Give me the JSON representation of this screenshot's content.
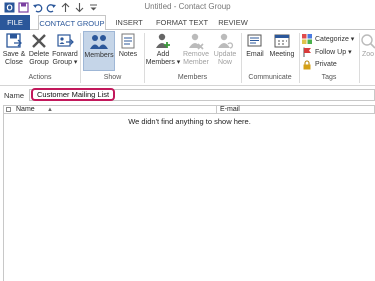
{
  "window": {
    "title": "Untitled - Contact Group"
  },
  "tabs": {
    "file": "FILE",
    "contact_group": "CONTACT GROUP",
    "insert": "INSERT",
    "format_text": "FORMAT TEXT",
    "review": "REVIEW"
  },
  "ribbon": {
    "actions": {
      "group_label": "Actions",
      "save_close": [
        "Save &",
        "Close"
      ],
      "delete_group": [
        "Delete",
        "Group"
      ],
      "forward_group": [
        "Forward",
        "Group ▾"
      ]
    },
    "show": {
      "group_label": "Show",
      "members": "Members",
      "notes": "Notes"
    },
    "members": {
      "group_label": "Members",
      "add_members": [
        "Add",
        "Members ▾"
      ],
      "remove_member": [
        "Remove",
        "Member"
      ],
      "update_now": [
        "Update",
        "Now"
      ]
    },
    "communicate": {
      "group_label": "Communicate",
      "email": "Email",
      "meeting": "Meeting"
    },
    "tags": {
      "group_label": "Tags",
      "categorize": "Categorize ▾",
      "follow_up": "Follow Up ▾",
      "private": "Private"
    },
    "zoom": {
      "label": "Zoo"
    }
  },
  "name_field": {
    "label": "Name",
    "value": "Customer Mailing List"
  },
  "list": {
    "col_name": "Name",
    "col_email": "E-mail",
    "sort_indicator": "▲",
    "empty_message": "We didn't find anything to show here."
  },
  "colors": {
    "accent": "#2b579a",
    "highlight_ring": "#c2185b",
    "selected_bg": "#c5d5e8"
  }
}
